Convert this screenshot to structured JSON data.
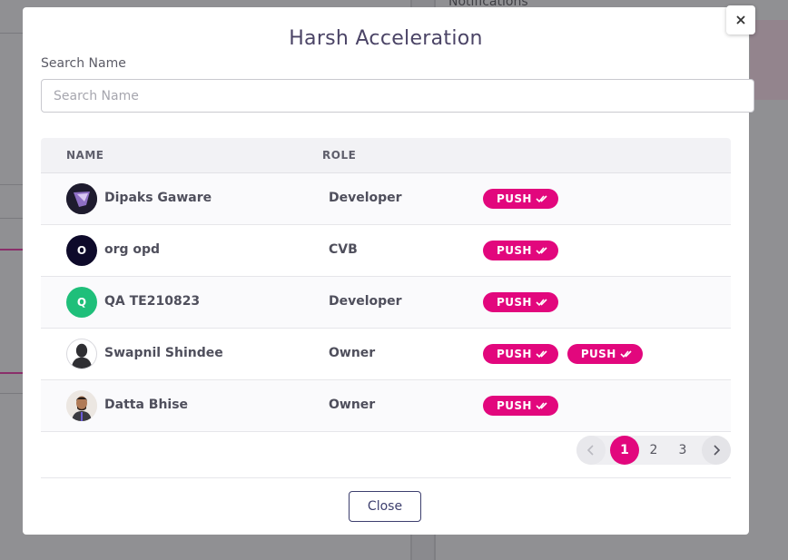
{
  "background": {
    "notifications_label": "Notifications"
  },
  "modal": {
    "title": "Harsh Acceleration",
    "search": {
      "label": "Search Name",
      "placeholder": "Search Name",
      "value": ""
    },
    "table": {
      "headers": {
        "name": "NAME",
        "role": "ROLE"
      },
      "rows": [
        {
          "name": "Dipaks Gaware",
          "role": "Developer",
          "avatar": "photo",
          "badges": [
            "PUSH"
          ]
        },
        {
          "name": "org opd",
          "role": "CVB",
          "avatar_letter": "O",
          "badges": [
            "PUSH"
          ]
        },
        {
          "name": "QA TE210823",
          "role": "Developer",
          "avatar_letter": "Q",
          "badges": [
            "PUSH"
          ]
        },
        {
          "name": "Swapnil Shindee",
          "role": "Owner",
          "avatar": "silhouette",
          "badges": [
            "PUSH",
            "PUSH"
          ]
        },
        {
          "name": "Datta Bhise",
          "role": "Owner",
          "avatar": "photo",
          "badges": [
            "PUSH"
          ]
        }
      ]
    },
    "pagination": {
      "pages": [
        "1",
        "2",
        "3"
      ],
      "active_page": "1",
      "prev_icon": "chevron-left-icon",
      "next_icon": "chevron-right-icon"
    },
    "close_label": "Close",
    "dismiss_icon": "close-icon"
  },
  "colors": {
    "accent": "#e2077d",
    "title": "#4b4466",
    "avatar_dark": "#0e0a2a",
    "avatar_green": "#1fbf7a",
    "button_border": "#3d3f6e"
  }
}
